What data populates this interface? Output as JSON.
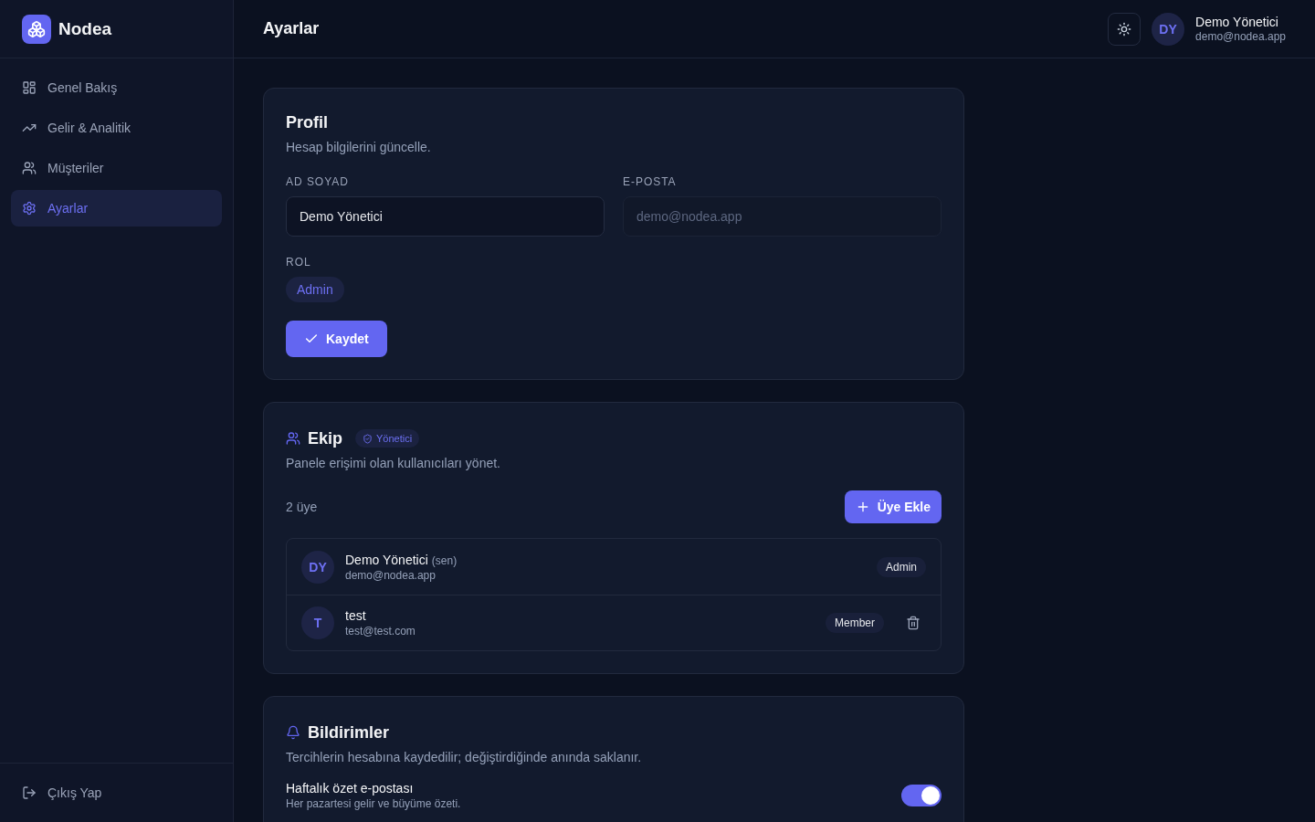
{
  "sidebar": {
    "brand": "Nodea",
    "items": [
      {
        "kind": "overview",
        "label": "Genel Bakış",
        "selected": false
      },
      {
        "kind": "analytics",
        "label": "Gelir & Analitik",
        "selected": false
      },
      {
        "kind": "customers",
        "label": "Müşteriler",
        "selected": false
      },
      {
        "kind": "settings",
        "label": "Ayarlar",
        "selected": true
      }
    ],
    "logout": "Çıkış Yap"
  },
  "header": {
    "title": "Ayarlar",
    "user": {
      "initials": "DY",
      "name": "Demo Yönetici",
      "email": "demo@nodea.app"
    }
  },
  "profile": {
    "title": "Profil",
    "subtitle": "Hesap bilgilerini güncelle.",
    "fields": [
      {
        "label": "AD SOYAD",
        "value": "Demo Yönetici",
        "disabled": false
      },
      {
        "label": "E-POSTA",
        "value": "demo@nodea.app",
        "disabled": true
      }
    ],
    "role_label": "ROL",
    "role": "Admin",
    "save_button": "Kaydet"
  },
  "team": {
    "title": "Ekip",
    "badge": "Yönetici",
    "subtitle": "Panele erişimi olan kullanıcıları yönet.",
    "count": "2 üye",
    "add_button": "Üye Ekle",
    "members": [
      {
        "initials": "DY",
        "name": "Demo Yönetici",
        "self_tag": "(sen)",
        "email": "demo@nodea.app",
        "role": "Admin",
        "deletable": false
      },
      {
        "initials": "T",
        "name": "test",
        "email": "test@test.com",
        "role": "Member",
        "deletable": true
      }
    ]
  },
  "notifications": {
    "title": "Bildirimler",
    "subtitle": "Tercihlerin hesabına kaydedilir; değiştirdiğinde anında saklanır.",
    "items": [
      {
        "title": "Haftalık özet e-postası",
        "description": "Her pazartesi gelir ve büyüme özeti.",
        "on": true
      }
    ]
  }
}
